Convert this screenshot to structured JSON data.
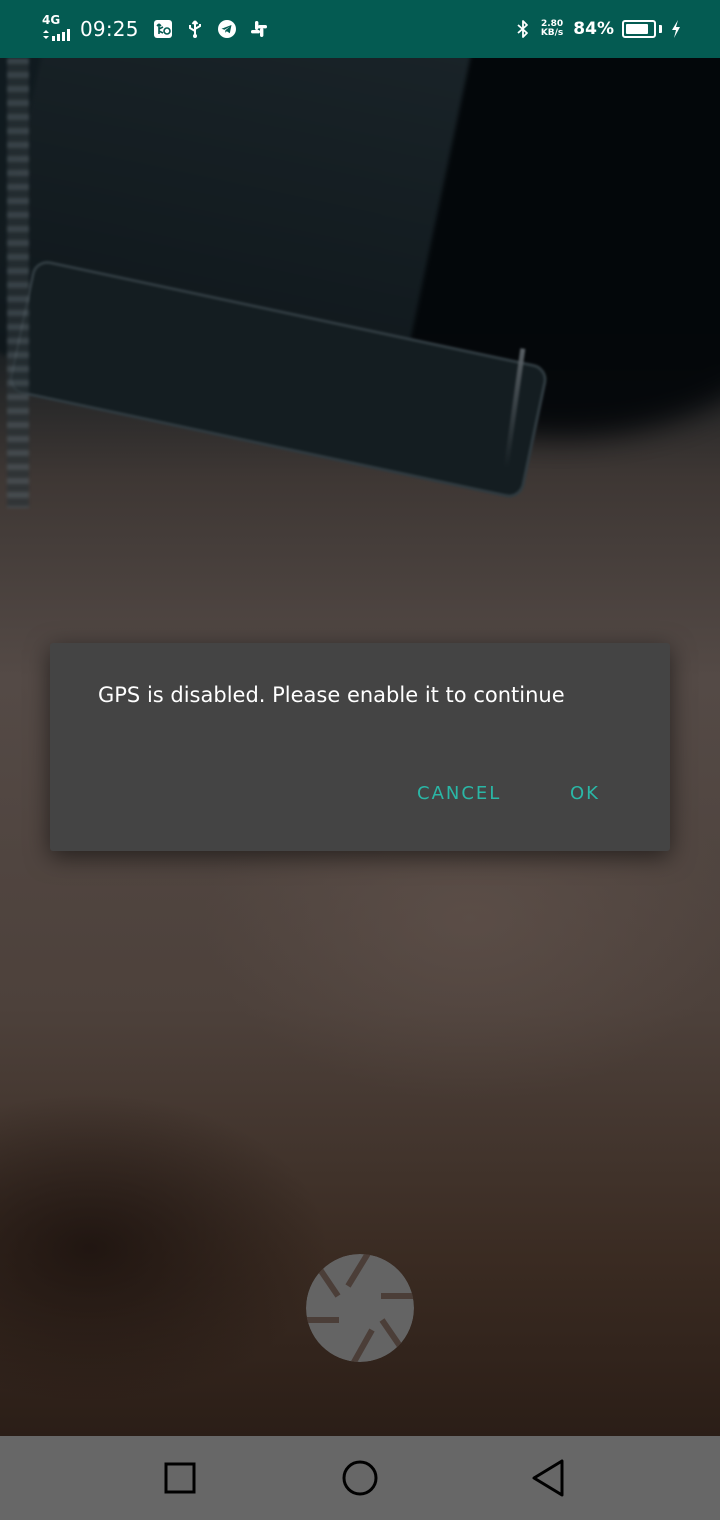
{
  "status_bar": {
    "network_type": "4G",
    "time": "09:25",
    "data_speed_value": "2.80",
    "data_speed_unit": "KB/s",
    "battery_percent": "84%",
    "battery_level": 0.84,
    "icons": [
      "signal-icon",
      "usb-debug-icon",
      "usb-icon",
      "telegram-icon",
      "slack-icon",
      "bluetooth-icon",
      "battery-icon",
      "charging-icon"
    ],
    "background_color": "#045b52"
  },
  "dialog": {
    "message": "GPS is disabled. Please enable it to continue",
    "cancel_label": "CANCEL",
    "ok_label": "OK",
    "accent_color": "#2ab7a6"
  },
  "camera": {
    "shutter_icon": "aperture-icon"
  },
  "nav_bar": {
    "recents_icon": "square-icon",
    "home_icon": "circle-icon",
    "back_icon": "triangle-back-icon"
  }
}
